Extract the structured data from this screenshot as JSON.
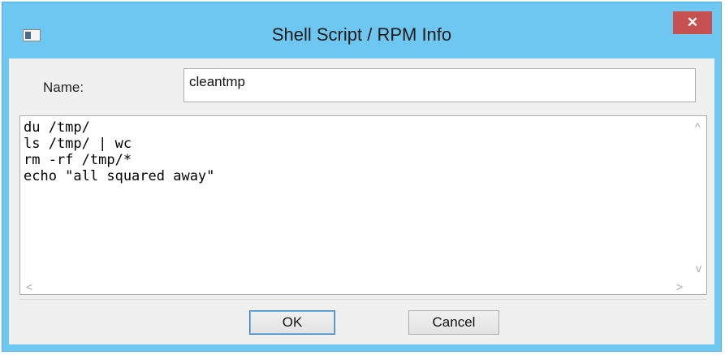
{
  "window": {
    "title": "Shell Script / RPM Info",
    "close_symbol": "✕"
  },
  "form": {
    "name_label": "Name:",
    "name_value": "cleantmp",
    "script_lines": [
      "du /tmp/",
      "ls /tmp/ | wc",
      "rm -rf /tmp/*",
      "echo \"all squared away\""
    ]
  },
  "scrollbars": {
    "up_arrow": "^",
    "down_arrow": "v",
    "left_arrow": "<",
    "right_arrow": ">"
  },
  "buttons": {
    "ok_label": "OK",
    "cancel_label": "Cancel"
  },
  "icons": {
    "app": "window-app-icon",
    "close": "close-icon"
  },
  "colors": {
    "frame": "#6ec7f0",
    "close_button": "#c75050",
    "client_background": "#f0f0f0"
  }
}
